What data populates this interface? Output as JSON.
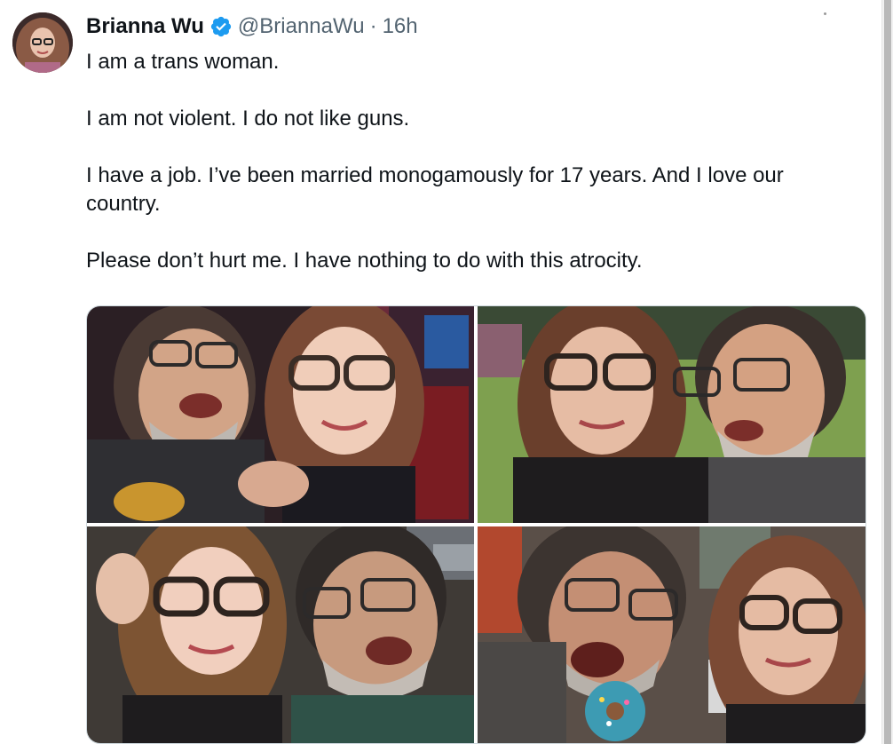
{
  "tweet": {
    "author_name": "Brianna Wu",
    "handle": "@BriannaWu",
    "separator": "·",
    "time": "16h",
    "paragraphs": [
      "I am a trans woman.",
      "I am not violent. I do not like guns.",
      "I have a job. I’ve been married monogamously for 17 years. And I love our country.",
      "Please don’t hurt me. I have nothing to do with this atrocity."
    ]
  },
  "colors": {
    "text_primary": "#0f1419",
    "text_secondary": "#536471",
    "verified_badge": "#1d9bf0",
    "border": "#cfd9de"
  },
  "icons": {
    "verified": "verified-badge-icon",
    "more": "more-options-icon"
  },
  "photos": [
    {
      "alt_name": "selfie-photo-1"
    },
    {
      "alt_name": "selfie-photo-2"
    },
    {
      "alt_name": "selfie-photo-3"
    },
    {
      "alt_name": "selfie-photo-4"
    }
  ]
}
